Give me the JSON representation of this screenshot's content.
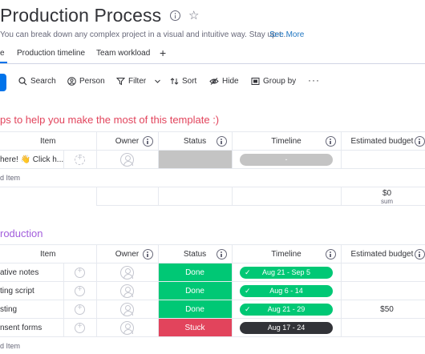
{
  "header": {
    "title": "Production Process",
    "description": "You can break down any complex project in a visual and intuitive way. Stay up-t...",
    "see_more": "See More"
  },
  "tabs": [
    {
      "label": "e",
      "active": true
    },
    {
      "label": "Production timeline",
      "active": false
    },
    {
      "label": "Team workload",
      "active": false
    },
    {
      "label": "+",
      "active": false
    }
  ],
  "toolbar": {
    "search": "Search",
    "person": "Person",
    "filter": "Filter",
    "sort": "Sort",
    "hide": "Hide",
    "group_by": "Group by",
    "more": "···"
  },
  "columns": {
    "item": "Item",
    "owner": "Owner",
    "status": "Status",
    "timeline": "Timeline",
    "budget": "Estimated budget"
  },
  "groups": [
    {
      "title": "ps to help you make the most of this template :)",
      "color": "#e2445c",
      "rows": [
        {
          "item": "here! 👋 Click h...",
          "status": "",
          "timeline": "-",
          "budget": ""
        }
      ],
      "add_item": "d Item",
      "summary": {
        "value": "$0",
        "label": "sum"
      }
    },
    {
      "title": "roduction",
      "color": "#a25ddc",
      "rows": [
        {
          "item": "ative notes",
          "status": "Done",
          "timeline": "Aug 21 - Sep 5",
          "budget": ""
        },
        {
          "item": "ting script",
          "status": "Done",
          "timeline": "Aug 6 - 14",
          "budget": ""
        },
        {
          "item": "sting",
          "status": "Done",
          "timeline": "Aug 21 - 29",
          "budget": "$50"
        },
        {
          "item": "nsent forms",
          "status": "Stuck",
          "timeline": "Aug 17 - 24",
          "budget": ""
        }
      ],
      "add_item": "d Item"
    }
  ],
  "colors": {
    "accent": "#0073ea",
    "done": "#00c875",
    "stuck": "#e2445c",
    "group1": "#e2445c",
    "group2": "#a25ddc"
  }
}
